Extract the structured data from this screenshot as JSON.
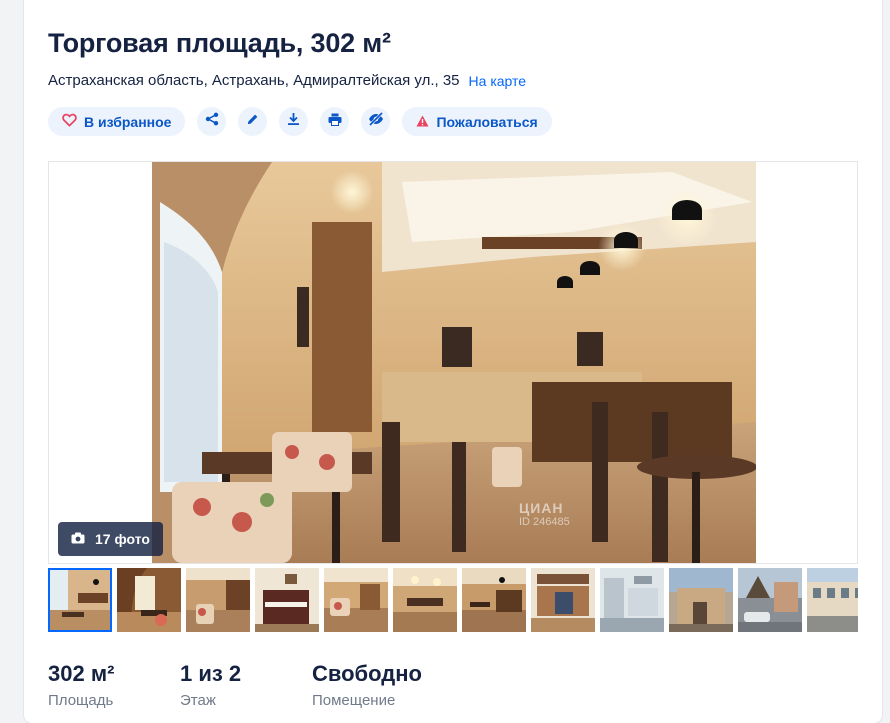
{
  "listing": {
    "title": "Торговая площадь, 302 м²",
    "address": "Астраханская область, Астрахань, Адмиралтейская ул., 35",
    "map_link": "На карте"
  },
  "actions": {
    "favorite_label": "В избранное",
    "report_label": "Пожаловаться",
    "icons": [
      "heart-icon",
      "share-icon",
      "pencil-icon",
      "download-icon",
      "print-icon",
      "eye-off-icon",
      "warning-icon"
    ],
    "accent_color": "#0468ff",
    "favorite_icon_color": "#e84260",
    "report_icon_color": "#e84260"
  },
  "gallery": {
    "photo_count_label": "17 фото",
    "watermark_brand": "ЦИАН",
    "watermark_id": "ID 246485",
    "thumbnail_count": 12
  },
  "stats": [
    {
      "value": "302 м²",
      "label": "Площадь"
    },
    {
      "value": "1 из 2",
      "label": "Этаж"
    },
    {
      "value": "Свободно",
      "label": "Помещение"
    }
  ]
}
